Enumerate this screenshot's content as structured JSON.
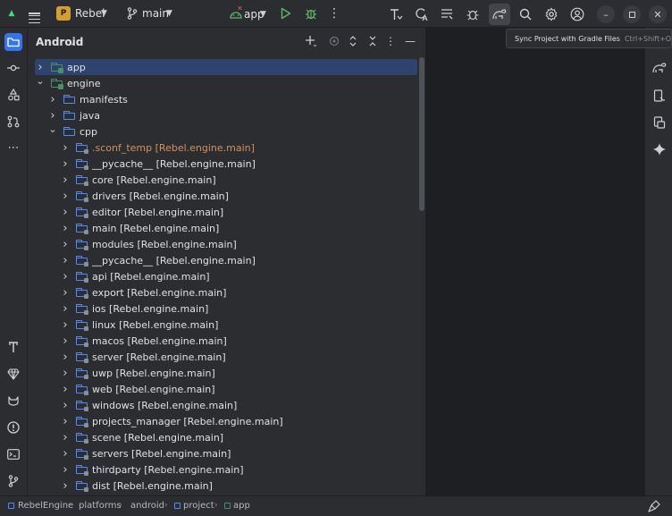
{
  "titlebar": {
    "project_badge": "P",
    "project_name": "Rebel",
    "branch": "main",
    "run_config": "app"
  },
  "tooltip": {
    "text": "Sync Project with Gradle Files",
    "shortcut": "Ctrl+Shift+O"
  },
  "panel": {
    "title": "Android"
  },
  "tree": [
    {
      "label": "app",
      "suffix": "",
      "type": "module",
      "expanded": false,
      "selected": true
    },
    {
      "label": "engine",
      "suffix": "",
      "type": "module",
      "expanded": true
    },
    {
      "label": "manifests",
      "suffix": "",
      "type": "folder",
      "expanded": false
    },
    {
      "label": "java",
      "suffix": "",
      "type": "folder",
      "expanded": false
    },
    {
      "label": "cpp",
      "suffix": "",
      "type": "folder",
      "expanded": true
    },
    {
      "label": ".sconf_temp",
      "suffix": "[Rebel.engine.main]",
      "type": "cfolder",
      "expanded": false,
      "highlight": "orange"
    },
    {
      "label": "__pycache__",
      "suffix": "[Rebel.engine.main]",
      "type": "cfolder",
      "expanded": false
    },
    {
      "label": "core",
      "suffix": "[Rebel.engine.main]",
      "type": "cfolder",
      "expanded": false
    },
    {
      "label": "drivers",
      "suffix": "[Rebel.engine.main]",
      "type": "cfolder",
      "expanded": false
    },
    {
      "label": "editor",
      "suffix": "[Rebel.engine.main]",
      "type": "cfolder",
      "expanded": false
    },
    {
      "label": "main",
      "suffix": "[Rebel.engine.main]",
      "type": "cfolder",
      "expanded": false
    },
    {
      "label": "modules",
      "suffix": "[Rebel.engine.main]",
      "type": "cfolder",
      "expanded": false
    },
    {
      "label": "__pycache__",
      "suffix": "[Rebel.engine.main]",
      "type": "cfolder",
      "expanded": false
    },
    {
      "label": "api",
      "suffix": "[Rebel.engine.main]",
      "type": "cfolder",
      "expanded": false
    },
    {
      "label": "export",
      "suffix": "[Rebel.engine.main]",
      "type": "cfolder",
      "expanded": false
    },
    {
      "label": "ios",
      "suffix": "[Rebel.engine.main]",
      "type": "cfolder",
      "expanded": false
    },
    {
      "label": "linux",
      "suffix": "[Rebel.engine.main]",
      "type": "cfolder",
      "expanded": false
    },
    {
      "label": "macos",
      "suffix": "[Rebel.engine.main]",
      "type": "cfolder",
      "expanded": false
    },
    {
      "label": "server",
      "suffix": "[Rebel.engine.main]",
      "type": "cfolder",
      "expanded": false
    },
    {
      "label": "uwp",
      "suffix": "[Rebel.engine.main]",
      "type": "cfolder",
      "expanded": false
    },
    {
      "label": "web",
      "suffix": "[Rebel.engine.main]",
      "type": "cfolder",
      "expanded": false
    },
    {
      "label": "windows",
      "suffix": "[Rebel.engine.main]",
      "type": "cfolder",
      "expanded": false
    },
    {
      "label": "projects_manager",
      "suffix": "[Rebel.engine.main]",
      "type": "cfolder",
      "expanded": false
    },
    {
      "label": "scene",
      "suffix": "[Rebel.engine.main]",
      "type": "cfolder",
      "expanded": false
    },
    {
      "label": "servers",
      "suffix": "[Rebel.engine.main]",
      "type": "cfolder",
      "expanded": false
    },
    {
      "label": "thirdparty",
      "suffix": "[Rebel.engine.main]",
      "type": "cfolder",
      "expanded": false
    },
    {
      "label": "dist",
      "suffix": "[Rebel.engine.main]",
      "type": "cfolder",
      "expanded": false
    }
  ],
  "breadcrumb": [
    "RebelEngine",
    "platforms",
    "android",
    "project",
    "app"
  ],
  "colors": {
    "accent": "#3574f0",
    "selection": "#2e436e",
    "highlight_orange": "#d4915b",
    "run_green": "#5fb865"
  }
}
